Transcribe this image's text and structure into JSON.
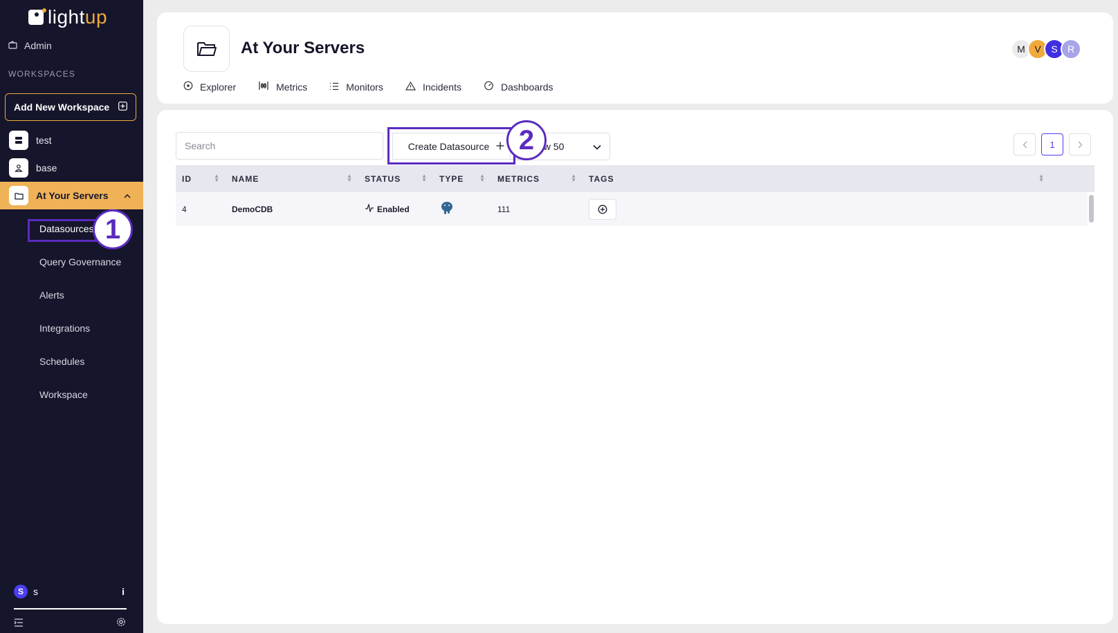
{
  "brand": {
    "text_a": "light",
    "text_b": "up"
  },
  "sidebar": {
    "admin_label": "Admin",
    "workspaces_heading": "WORKSPACES",
    "add_workspace_label": "Add New Workspace",
    "workspaces": [
      {
        "label": "test"
      },
      {
        "label": "base"
      },
      {
        "label": "At Your Servers"
      }
    ],
    "sub_items": [
      {
        "label": "Datasources"
      },
      {
        "label": "Query Governance"
      },
      {
        "label": "Alerts"
      },
      {
        "label": "Integrations"
      },
      {
        "label": "Schedules"
      },
      {
        "label": "Workspace"
      }
    ],
    "user": {
      "initial": "S",
      "name": "s",
      "info": "i"
    }
  },
  "annotations": {
    "step1": "1",
    "step2": "2"
  },
  "header": {
    "title": "At Your Servers",
    "tabs": [
      {
        "label": "Explorer"
      },
      {
        "label": "Metrics"
      },
      {
        "label": "Monitors"
      },
      {
        "label": "Incidents"
      },
      {
        "label": "Dashboards"
      }
    ],
    "avatars": [
      {
        "initial": "M",
        "color": "#ebebeb"
      },
      {
        "initial": "V",
        "color": "#f0a93b"
      },
      {
        "initial": "S",
        "color": "#3f2fe0"
      },
      {
        "initial": "R",
        "color": "#a8a4e8"
      }
    ]
  },
  "toolbar": {
    "search_placeholder": "Search",
    "create_label": "Create Datasource",
    "show_label": "ow 50",
    "page_current": "1"
  },
  "table": {
    "columns": [
      "ID",
      "NAME",
      "STATUS",
      "TYPE",
      "METRICS",
      "TAGS"
    ],
    "rows": [
      {
        "id": "4",
        "name": "DemoCDB",
        "status": "Enabled",
        "type_icon": "postgres-elephant-icon",
        "metrics": "111"
      }
    ]
  },
  "colors": {
    "accent": "#f0a93b",
    "sidebar": "#15152b",
    "annotation": "#5a2bbf",
    "primary": "#4b3ff0"
  }
}
